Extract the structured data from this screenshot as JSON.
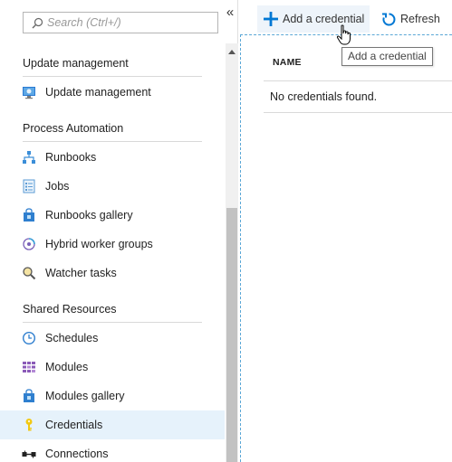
{
  "search": {
    "placeholder": "Search (Ctrl+/)"
  },
  "sidebar": {
    "collapse_glyph": "«",
    "sections": [
      {
        "title": "Update management",
        "items": [
          {
            "label": "Update management",
            "icon": "update-management-icon"
          }
        ]
      },
      {
        "title": "Process Automation",
        "items": [
          {
            "label": "Runbooks",
            "icon": "runbooks-icon"
          },
          {
            "label": "Jobs",
            "icon": "jobs-icon"
          },
          {
            "label": "Runbooks gallery",
            "icon": "runbooks-gallery-icon"
          },
          {
            "label": "Hybrid worker groups",
            "icon": "hybrid-worker-groups-icon"
          },
          {
            "label": "Watcher tasks",
            "icon": "watcher-tasks-icon"
          }
        ]
      },
      {
        "title": "Shared Resources",
        "items": [
          {
            "label": "Schedules",
            "icon": "schedules-icon"
          },
          {
            "label": "Modules",
            "icon": "modules-icon"
          },
          {
            "label": "Modules gallery",
            "icon": "modules-gallery-icon"
          },
          {
            "label": "Credentials",
            "icon": "key-icon",
            "selected": true
          },
          {
            "label": "Connections",
            "icon": "connections-icon"
          }
        ]
      }
    ]
  },
  "toolbar": {
    "add_label": "Add a credential",
    "refresh_label": "Refresh"
  },
  "tooltip": {
    "text": "Add a credential"
  },
  "table": {
    "columns": [
      "NAME"
    ],
    "empty_message": "No credentials found."
  },
  "colors": {
    "accent": "#0078d4",
    "selected_bg": "#e6f2fb",
    "key": "#f2c811"
  }
}
